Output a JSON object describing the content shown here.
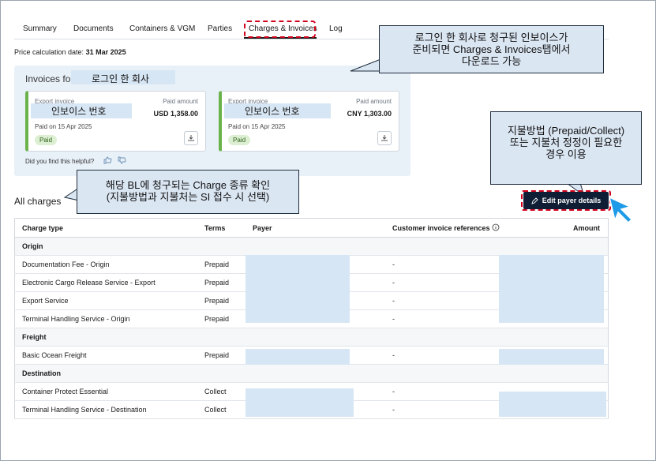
{
  "tabs": [
    {
      "label": "Summary"
    },
    {
      "label": "Documents"
    },
    {
      "label": "Containers & VGM"
    },
    {
      "label": "Parties"
    },
    {
      "label": "Charges & Invoices"
    },
    {
      "label": "Log"
    }
  ],
  "price_calc": {
    "label": "Price calculation date:",
    "value": "31 Mar 2025"
  },
  "invoices": {
    "title": "Invoices for",
    "company_redacted": "로그인 한 회사",
    "cards": [
      {
        "type_label": "Export invoice",
        "number_redacted": "인보이스 번호",
        "paid_label": "Paid amount",
        "amount": "USD 1,358.00",
        "paid_on": "Paid on 15 Apr 2025",
        "status": "Paid"
      },
      {
        "type_label": "Export invoice",
        "number_redacted": "인보이스 번호",
        "paid_label": "Paid amount",
        "amount": "CNY 1,303.00",
        "paid_on": "Paid on 15 Apr 2025",
        "status": "Paid"
      }
    ],
    "helpful": "Did you find this helpful?"
  },
  "callouts": {
    "top": "로그인 한 회사로 청구된 인보이스가\n준비되면 Charges & Invoices탭에서\n다운로드 가능",
    "right": "지불방법 (Prepaid/Collect)\n또는 지불처 정정이 필요한\n경우 이용",
    "left": "해당 BL에 청구되는 Charge 종류 확인\n(지불방법과 지불처는 SI 접수 시 선택)"
  },
  "all_charges": {
    "title": "All charges",
    "edit_button": "Edit payer details"
  },
  "table": {
    "headers": [
      "Charge type",
      "Terms",
      "Payer",
      "Customer invoice references",
      "Amount"
    ],
    "rows": [
      {
        "section": "Origin"
      },
      {
        "charge": "Documentation Fee - Origin",
        "terms": "Prepaid",
        "ref": "-"
      },
      {
        "charge": "Electronic Cargo Release Service - Export",
        "terms": "Prepaid",
        "ref": "-"
      },
      {
        "charge": "Export Service",
        "terms": "Prepaid",
        "ref": "-"
      },
      {
        "charge": "Terminal Handling Service - Origin",
        "terms": "Prepaid",
        "ref": "-"
      },
      {
        "section": "Freight"
      },
      {
        "charge": "Basic Ocean Freight",
        "terms": "Prepaid",
        "ref": "-"
      },
      {
        "section": "Destination"
      },
      {
        "charge": "Container Protect Essential",
        "terms": "Collect",
        "ref": "-"
      },
      {
        "charge": "Terminal Handling Service - Destination",
        "terms": "Collect",
        "ref": "-"
      }
    ]
  },
  "colors": {
    "accent_dark": "#0f1e35",
    "highlight_red": "#d0021b",
    "paid_green": "#6ab34a",
    "callout_bg": "#dbe6f3",
    "cursor_blue": "#1e9be8"
  }
}
